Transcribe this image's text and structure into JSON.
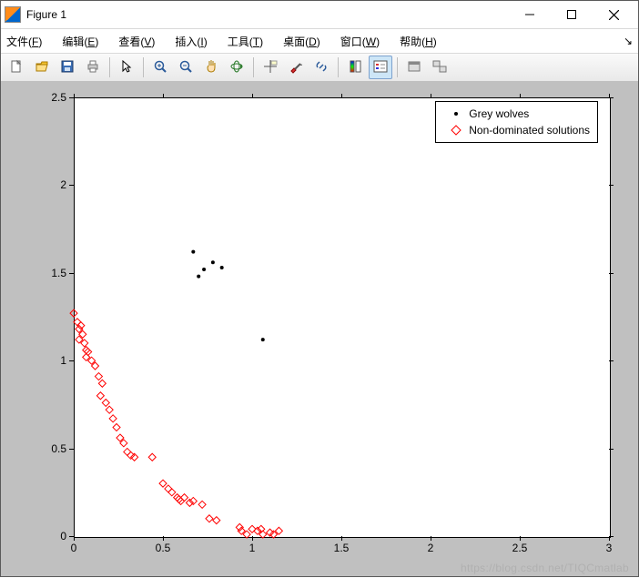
{
  "titlebar": {
    "title": "Figure 1"
  },
  "menubar": {
    "items": [
      {
        "label": "文件",
        "accel": "F"
      },
      {
        "label": "编辑",
        "accel": "E"
      },
      {
        "label": "查看",
        "accel": "V"
      },
      {
        "label": "插入",
        "accel": "I"
      },
      {
        "label": "工具",
        "accel": "T"
      },
      {
        "label": "桌面",
        "accel": "D"
      },
      {
        "label": "窗口",
        "accel": "W"
      },
      {
        "label": "帮助",
        "accel": "H"
      }
    ]
  },
  "toolbar": {
    "groups": [
      [
        "new",
        "open",
        "save",
        "print"
      ],
      [
        "pointer"
      ],
      [
        "zoom-in",
        "zoom-out",
        "pan",
        "rotate3d"
      ],
      [
        "data-cursor",
        "brush",
        "link"
      ],
      [
        "colorbar",
        "legend"
      ],
      [
        "hide-tools",
        "show-tools"
      ]
    ]
  },
  "legend": {
    "items": [
      {
        "marker": "dot",
        "color": "#000000",
        "label": "Grey wolves"
      },
      {
        "marker": "diamond",
        "color": "#ff0000",
        "label": "Non-dominated solutions"
      }
    ]
  },
  "watermark": "https://blog.csdn.net/TIQCmatlab",
  "chart_data": {
    "type": "scatter",
    "xlim": [
      0,
      3
    ],
    "ylim": [
      0,
      2.5
    ],
    "xticks": [
      0,
      0.5,
      1,
      1.5,
      2,
      2.5,
      3
    ],
    "yticks": [
      0,
      0.5,
      1,
      1.5,
      2,
      2.5
    ],
    "xlabel": "",
    "ylabel": "",
    "title": "",
    "series": [
      {
        "name": "Grey wolves",
        "marker": "dot",
        "color": "#000000",
        "points": [
          [
            0.67,
            1.62
          ],
          [
            0.7,
            1.48
          ],
          [
            0.73,
            1.52
          ],
          [
            0.78,
            1.56
          ],
          [
            0.83,
            1.53
          ],
          [
            1.06,
            1.12
          ]
        ]
      },
      {
        "name": "Non-dominated solutions",
        "marker": "diamond",
        "color": "#ff0000",
        "points": [
          [
            0.0,
            1.27
          ],
          [
            0.02,
            1.22
          ],
          [
            0.03,
            1.18
          ],
          [
            0.04,
            1.2
          ],
          [
            0.05,
            1.15
          ],
          [
            0.03,
            1.12
          ],
          [
            0.06,
            1.1
          ],
          [
            0.07,
            1.06
          ],
          [
            0.08,
            1.05
          ],
          [
            0.07,
            1.02
          ],
          [
            0.1,
            1.0
          ],
          [
            0.12,
            0.97
          ],
          [
            0.14,
            0.91
          ],
          [
            0.16,
            0.87
          ],
          [
            0.15,
            0.8
          ],
          [
            0.18,
            0.76
          ],
          [
            0.2,
            0.72
          ],
          [
            0.22,
            0.67
          ],
          [
            0.24,
            0.62
          ],
          [
            0.26,
            0.56
          ],
          [
            0.28,
            0.53
          ],
          [
            0.3,
            0.48
          ],
          [
            0.34,
            0.45
          ],
          [
            0.32,
            0.46
          ],
          [
            0.44,
            0.45
          ],
          [
            0.5,
            0.3
          ],
          [
            0.53,
            0.27
          ],
          [
            0.55,
            0.25
          ],
          [
            0.58,
            0.22
          ],
          [
            0.59,
            0.21
          ],
          [
            0.62,
            0.22
          ],
          [
            0.6,
            0.2
          ],
          [
            0.65,
            0.19
          ],
          [
            0.67,
            0.2
          ],
          [
            0.72,
            0.18
          ],
          [
            0.76,
            0.1
          ],
          [
            0.8,
            0.09
          ],
          [
            0.93,
            0.05
          ],
          [
            0.94,
            0.03
          ],
          [
            0.97,
            0.01
          ],
          [
            1.0,
            0.04
          ],
          [
            1.03,
            0.03
          ],
          [
            1.06,
            0.01
          ],
          [
            1.05,
            0.04
          ],
          [
            1.1,
            0.02
          ],
          [
            1.12,
            0.01
          ],
          [
            1.15,
            0.03
          ]
        ]
      }
    ]
  }
}
